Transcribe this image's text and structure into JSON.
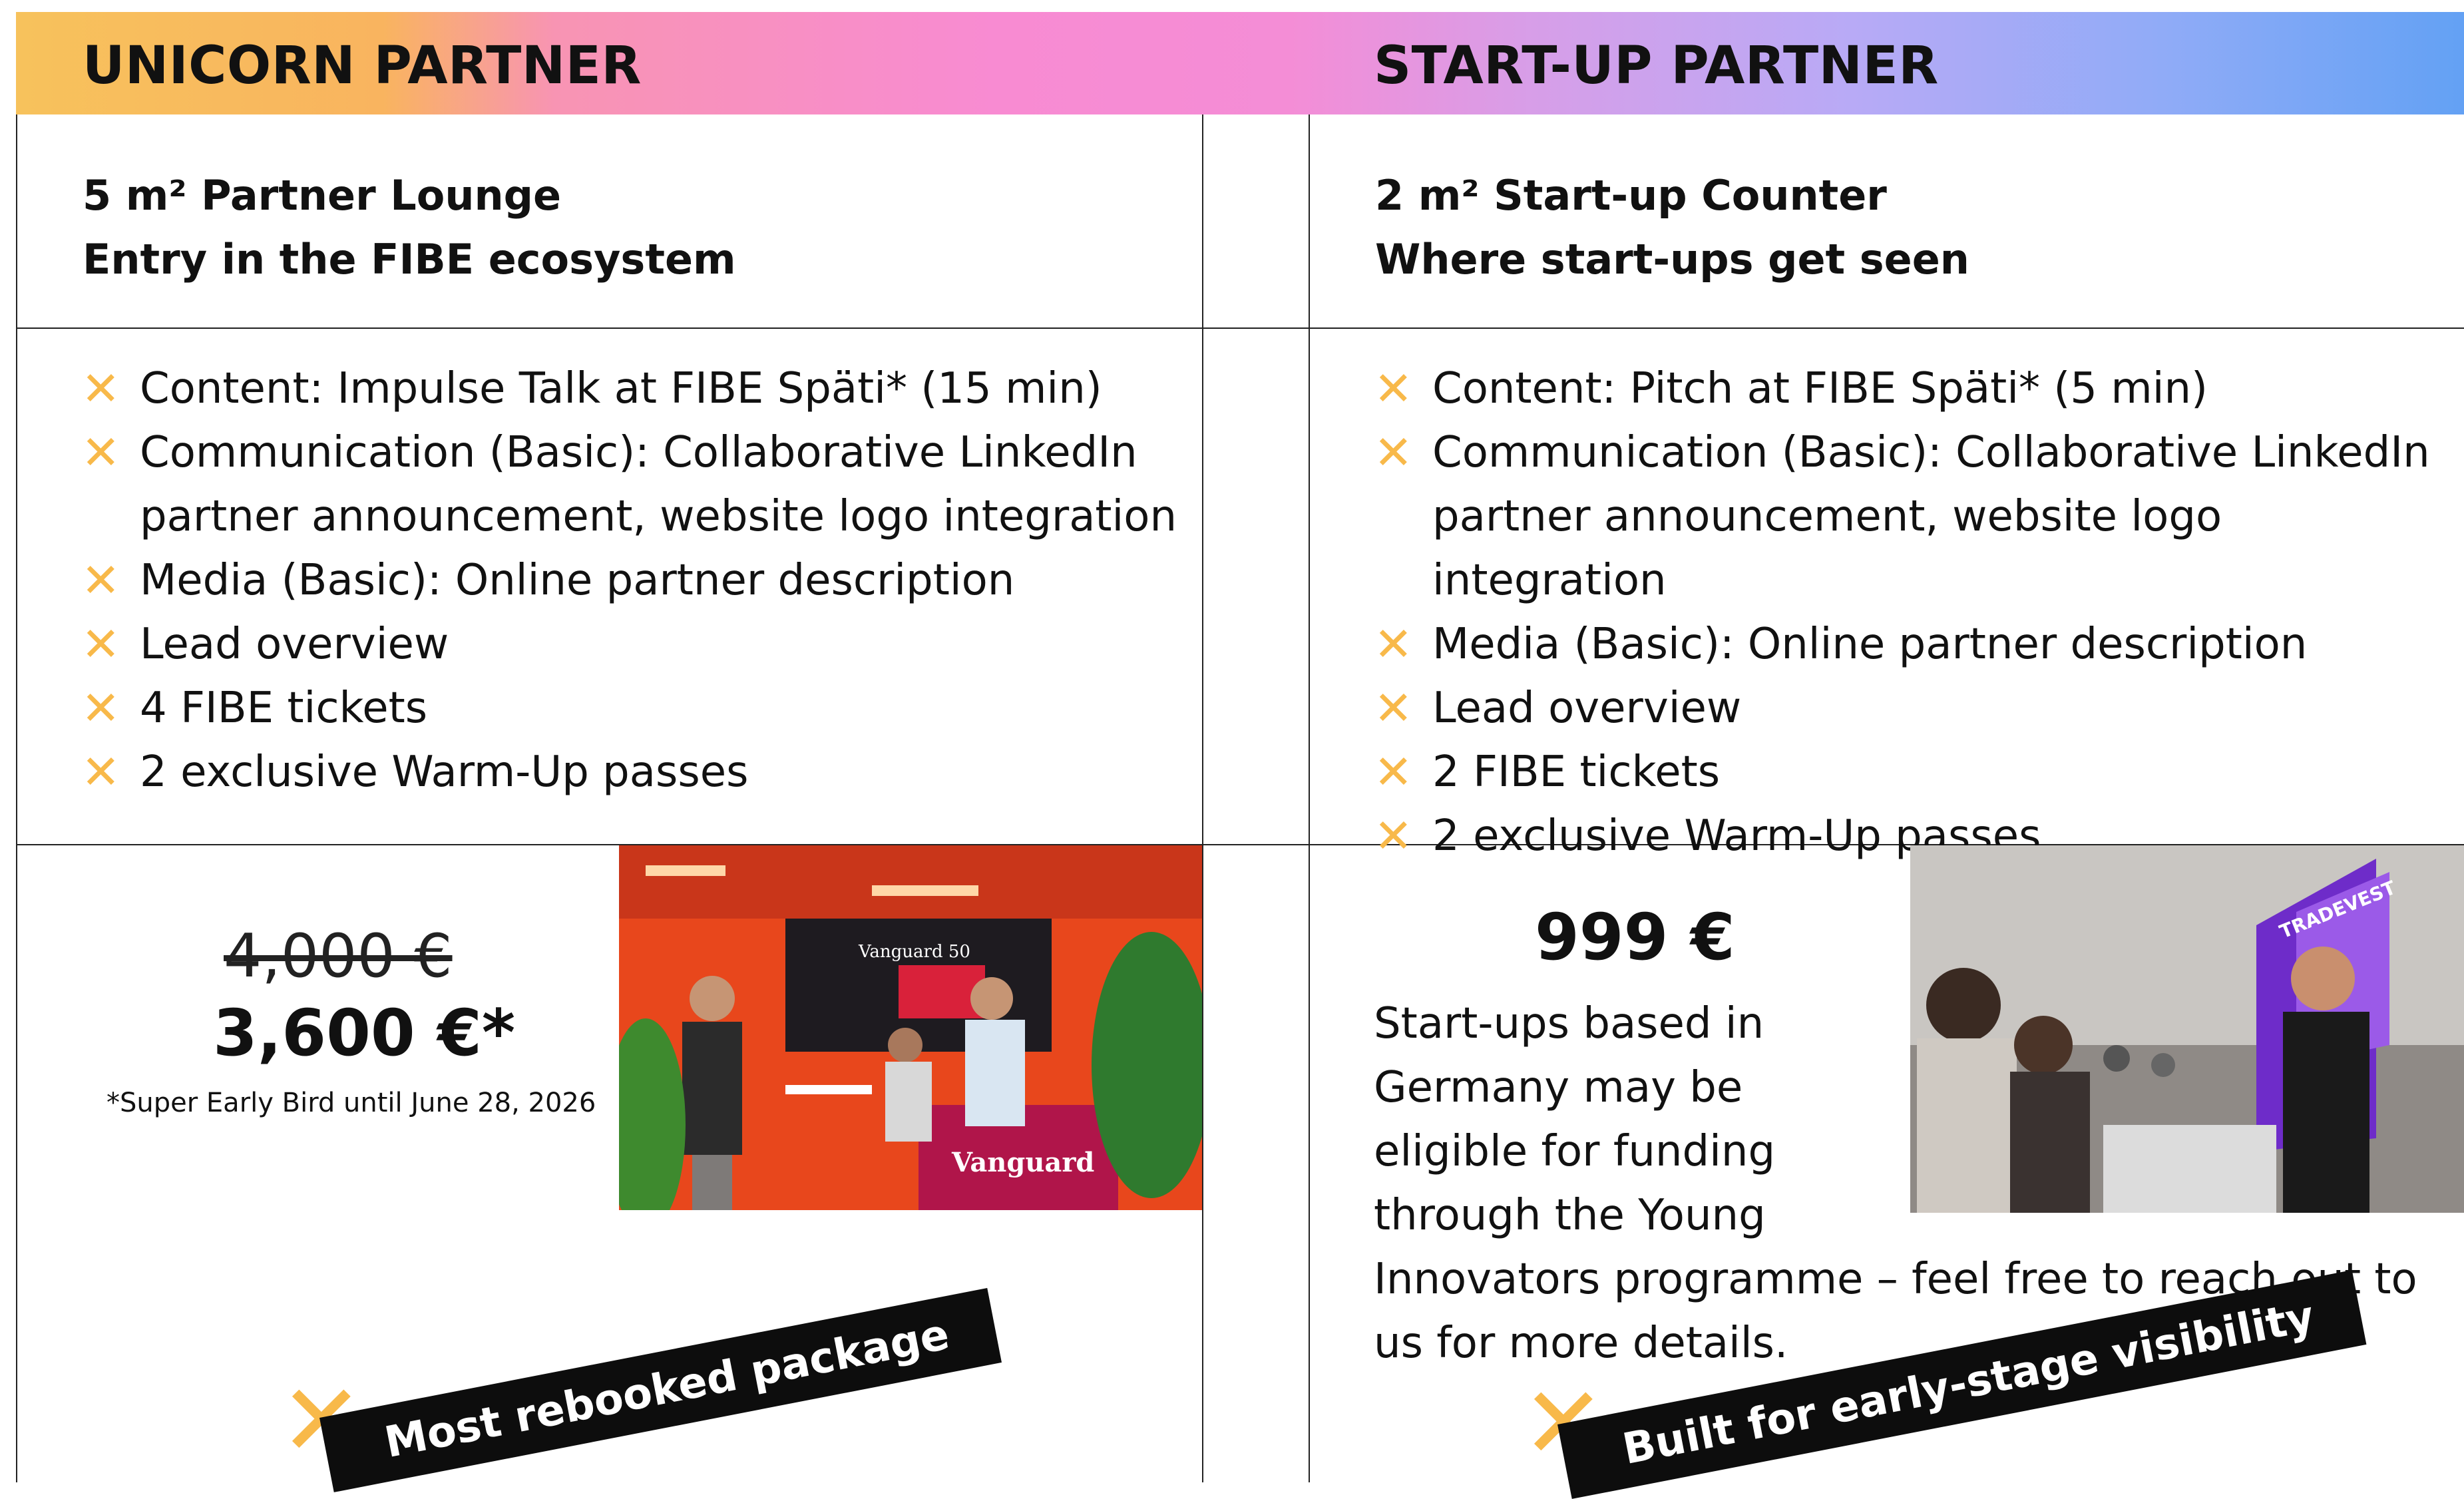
{
  "unicorn": {
    "title": "UNICORN PARTNER",
    "subtitle_line1": "5 m² Partner Lounge",
    "subtitle_line2": "Entry in the FIBE ecosystem",
    "features": [
      "Content: Impulse Talk at FIBE Späti* (15 min)",
      "Communication (Basic): Collaborative LinkedIn partner announcement, website logo integration",
      "Media (Basic): Online partner description",
      "Lead overview",
      "4 FIBE tickets",
      "2 exclusive Warm-Up passes"
    ],
    "old_price": "4,000 €",
    "price": "3,600 €*",
    "price_note": "*Super Early Bird until June 28, 2026",
    "ribbon": "Most rebooked package",
    "photo_sign": "Vanguard 50"
  },
  "startup": {
    "title": "START-UP PARTNER",
    "subtitle_line1": "2 m² Start-up Counter",
    "subtitle_line2": "Where start-ups get seen",
    "features": [
      "Content: Pitch at FIBE Späti* (5 min)",
      "Communication (Basic): Collaborative LinkedIn partner announcement, website logo integration",
      "Media (Basic): Online partner description",
      "Lead overview",
      "2 FIBE tickets",
      "2 exclusive Warm-Up passes"
    ],
    "price": "999 €",
    "funding_text": "Start-ups based in Germany may be eligible for funding through the Young Innovators programme – feel free to reach out to us for more details.",
    "ribbon": "Built for early-stage visibility",
    "photo_sign": "TRADEVEST"
  },
  "icons": {
    "bullet": "x-mark-icon"
  },
  "colors": {
    "accent": "#f8b94a",
    "ribbon_bg": "#0d0d0d"
  }
}
